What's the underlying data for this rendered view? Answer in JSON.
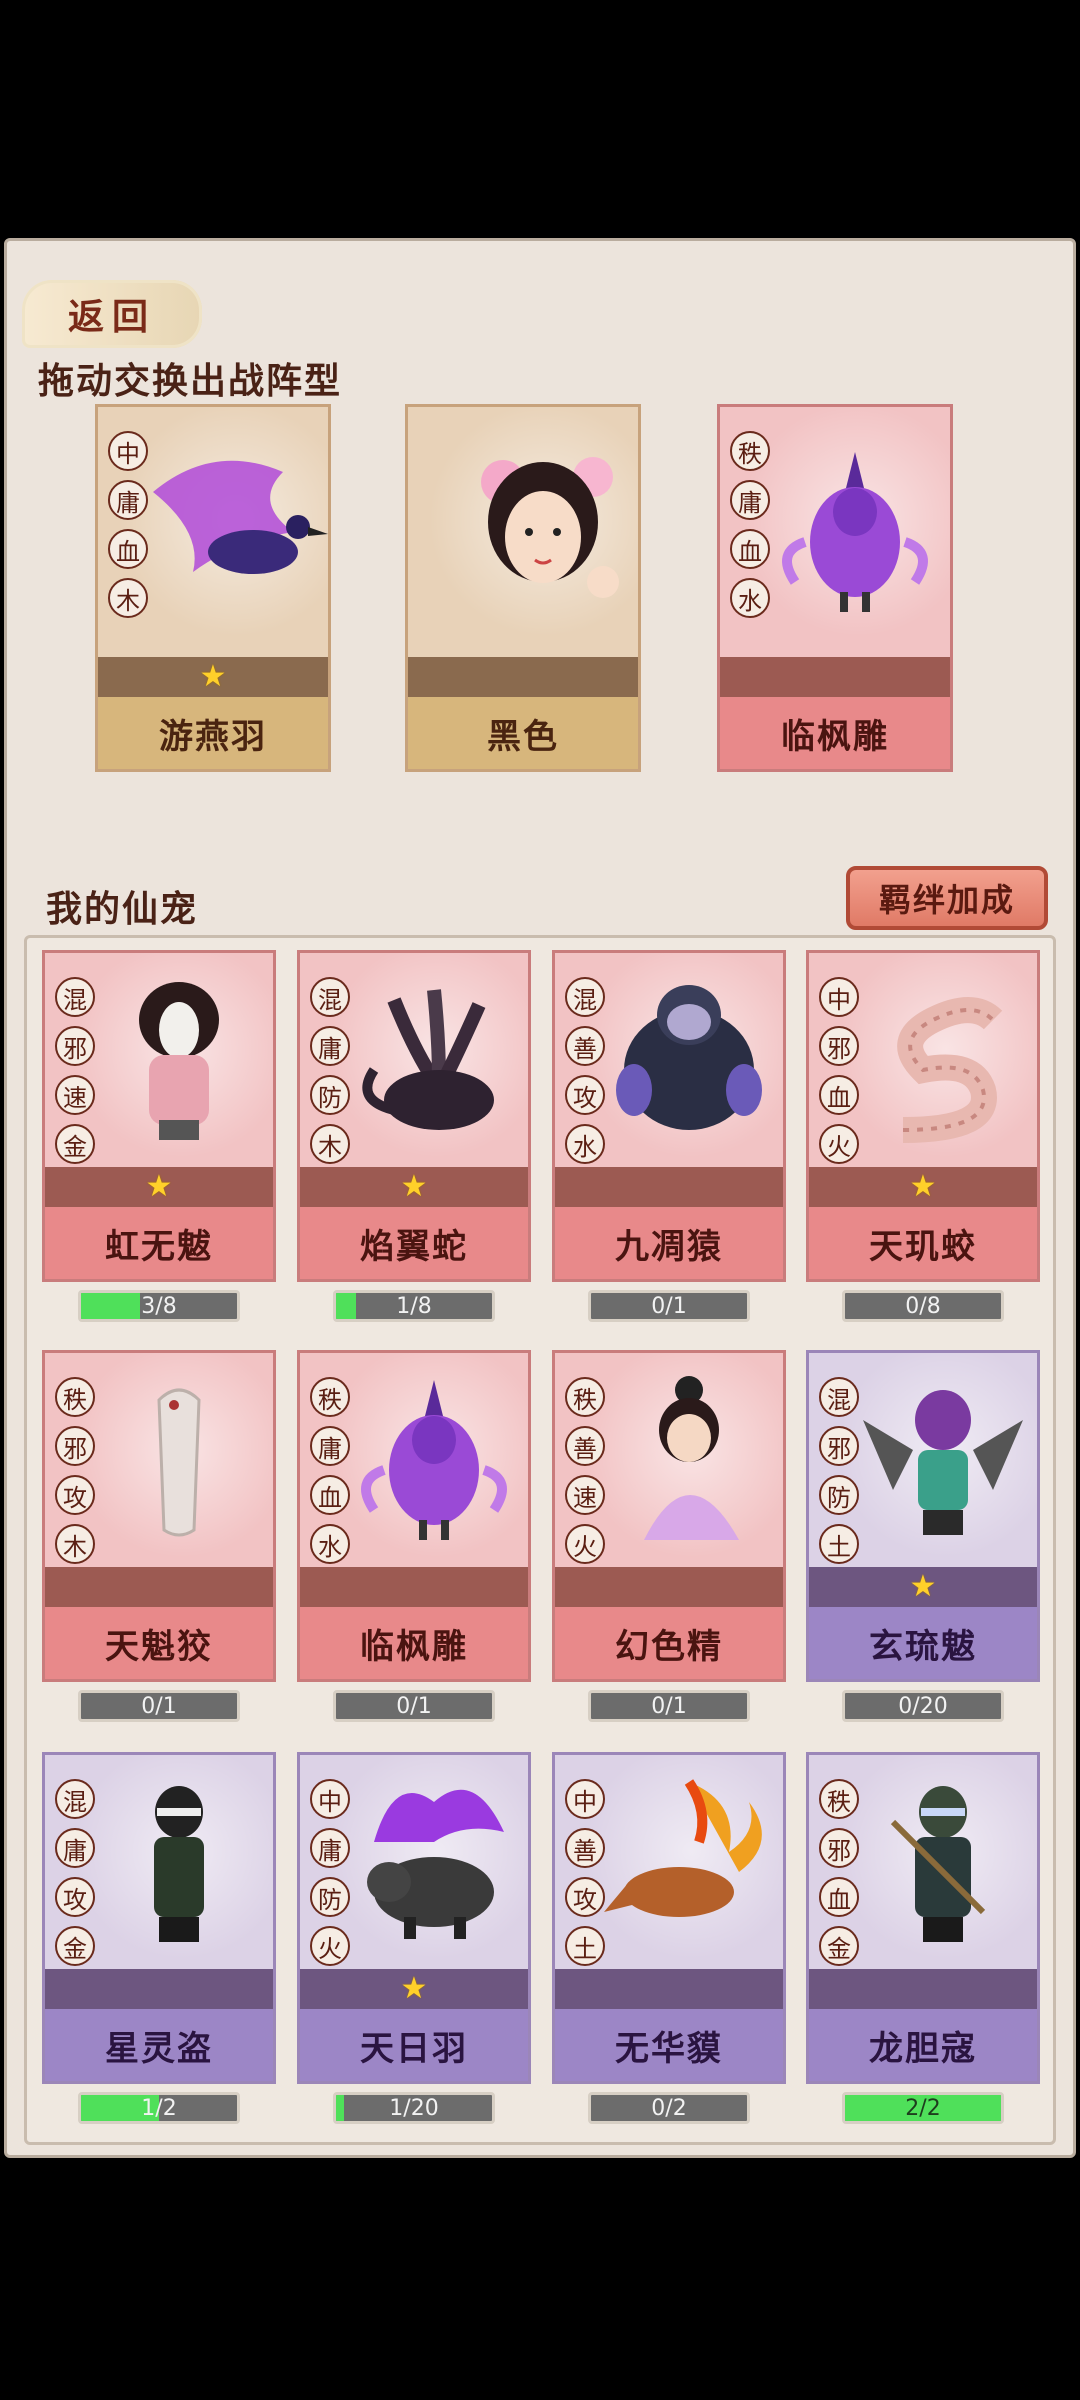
{
  "header": {
    "back_label": "返回"
  },
  "formation": {
    "title": "拖动交换出战阵型",
    "cards": [
      {
        "name": "游燕羽",
        "traits": [
          "中",
          "庸",
          "血",
          "木"
        ],
        "stars": 1,
        "theme": "tan",
        "art": "purple-bird"
      },
      {
        "name": "黑色",
        "traits": [],
        "stars": 0,
        "theme": "tan",
        "art": "portrait"
      },
      {
        "name": "临枫雕",
        "traits": [
          "秩",
          "庸",
          "血",
          "水"
        ],
        "stars": 0,
        "theme": "pink",
        "art": "purple-eagle"
      }
    ]
  },
  "pets": {
    "title": "我的仙宠",
    "bond_button": "羁绊加成",
    "cards": [
      {
        "name": "虹无魃",
        "traits": [
          "混",
          "邪",
          "速",
          "金"
        ],
        "stars": 1,
        "theme": "pink",
        "progress": "3/8",
        "fill": 0.375,
        "art": "ghost"
      },
      {
        "name": "焰翼蛇",
        "traits": [
          "混",
          "庸",
          "防",
          "木"
        ],
        "stars": 1,
        "theme": "pink",
        "progress": "1/8",
        "fill": 0.125,
        "art": "hydra"
      },
      {
        "name": "九凋猿",
        "traits": [
          "混",
          "善",
          "攻",
          "水"
        ],
        "stars": 0,
        "theme": "pink",
        "progress": "0/1",
        "fill": 0,
        "art": "ape"
      },
      {
        "name": "天玑蛟",
        "traits": [
          "中",
          "邪",
          "血",
          "火"
        ],
        "stars": 1,
        "theme": "pink",
        "progress": "0/8",
        "fill": 0,
        "art": "serpent"
      },
      {
        "name": "天魁狡",
        "traits": [
          "秩",
          "邪",
          "攻",
          "木"
        ],
        "stars": 0,
        "theme": "pink",
        "progress": "0/1",
        "fill": 0,
        "art": "worm"
      },
      {
        "name": "临枫雕",
        "traits": [
          "秩",
          "庸",
          "血",
          "水"
        ],
        "stars": 0,
        "theme": "pink",
        "progress": "0/1",
        "fill": 0,
        "art": "purple-eagle"
      },
      {
        "name": "幻色精",
        "traits": [
          "秩",
          "善",
          "速",
          "火"
        ],
        "stars": 0,
        "theme": "pink",
        "progress": "0/1",
        "fill": 0,
        "art": "girl"
      },
      {
        "name": "玄琉魃",
        "traits": [
          "混",
          "邪",
          "防",
          "土"
        ],
        "stars": 1,
        "theme": "purple",
        "progress": "0/20",
        "fill": 0,
        "art": "demon"
      },
      {
        "name": "星灵盗",
        "traits": [
          "混",
          "庸",
          "攻",
          "金"
        ],
        "stars": 0,
        "theme": "purple",
        "progress": "1/2",
        "fill": 0.5,
        "art": "ninja"
      },
      {
        "name": "天日羽",
        "traits": [
          "中",
          "庸",
          "防",
          "火"
        ],
        "stars": 1,
        "theme": "purple",
        "progress": "1/20",
        "fill": 0.05,
        "art": "boar"
      },
      {
        "name": "无华貘",
        "traits": [
          "中",
          "善",
          "攻",
          "土"
        ],
        "stars": 0,
        "theme": "purple",
        "progress": "0/2",
        "fill": 0,
        "art": "fox"
      },
      {
        "name": "龙胆寇",
        "traits": [
          "秩",
          "邪",
          "血",
          "金"
        ],
        "stars": 0,
        "theme": "purple",
        "progress": "2/2",
        "fill": 1,
        "art": "ninja2"
      }
    ]
  },
  "colors": {
    "panel": "#ece4dc",
    "title": "#4a2216",
    "progress_fill": "#4fe05a"
  }
}
